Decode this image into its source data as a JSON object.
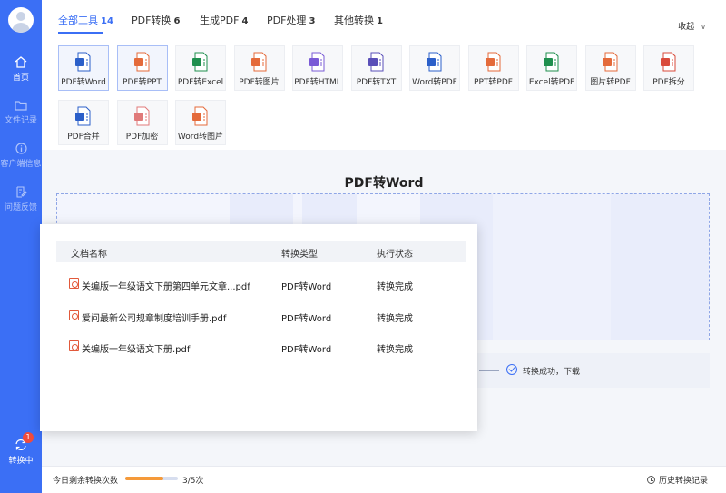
{
  "sidebar": {
    "items": [
      {
        "label": "首页",
        "icon": "home-icon"
      },
      {
        "label": "文件记录",
        "icon": "folder-icon"
      },
      {
        "label": "客户端信息",
        "icon": "info-icon"
      },
      {
        "label": "问题反馈",
        "icon": "feedback-icon"
      }
    ],
    "converting": {
      "label": "转换中",
      "badge": "1",
      "icon": "sync-icon"
    }
  },
  "header": {
    "tabs": [
      {
        "label": "全部工具",
        "count": "14"
      },
      {
        "label": "PDF转换",
        "count": "6"
      },
      {
        "label": "生成PDF",
        "count": "4"
      },
      {
        "label": "PDF处理",
        "count": "3"
      },
      {
        "label": "其他转换",
        "count": "1"
      }
    ],
    "collapse_label": "收起",
    "accent_color": "#3b6ff5"
  },
  "tools": [
    {
      "label": "PDF转Word",
      "icon": "word-icon",
      "color": "#2b5fc9"
    },
    {
      "label": "PDF转PPT",
      "icon": "ppt-icon",
      "color": "#e46a3a"
    },
    {
      "label": "PDF转Excel",
      "icon": "excel-icon",
      "color": "#1f8f4e"
    },
    {
      "label": "PDF转图片",
      "icon": "image-icon",
      "color": "#e46a3a"
    },
    {
      "label": "PDF转HTML",
      "icon": "html-icon",
      "color": "#7a5bd6"
    },
    {
      "label": "PDF转TXT",
      "icon": "txt-icon",
      "color": "#5a4fb8"
    },
    {
      "label": "Word转PDF",
      "icon": "word-to-pdf-icon",
      "color": "#2b5fc9"
    },
    {
      "label": "PPT转PDF",
      "icon": "ppt-to-pdf-icon",
      "color": "#e46a3a"
    },
    {
      "label": "Excel转PDF",
      "icon": "excel-to-pdf-icon",
      "color": "#1f8f4e"
    },
    {
      "label": "图片转PDF",
      "icon": "image-to-pdf-icon",
      "color": "#e46a3a"
    },
    {
      "label": "PDF拆分",
      "icon": "split-icon",
      "color": "#d94a3a"
    },
    {
      "label": "PDF合并",
      "icon": "merge-icon",
      "color": "#2b5fc9"
    },
    {
      "label": "PDF加密",
      "icon": "lock-icon",
      "color": "#e07a7a"
    },
    {
      "label": "Word转图片",
      "icon": "word-to-image-icon",
      "color": "#e46a3a"
    }
  ],
  "main": {
    "title": "PDF转Word",
    "status_text": "转换成功，下载"
  },
  "panel": {
    "headers": [
      "文档名称",
      "转换类型",
      "执行状态"
    ],
    "rows": [
      {
        "name": "关编版一年级语文下册第四单元文章...pdf",
        "type": "PDF转Word",
        "status": "转换完成"
      },
      {
        "name": "爱问最新公司规章制度培训手册.pdf",
        "type": "PDF转Word",
        "status": "转换完成"
      },
      {
        "name": "关编版一年级语文下册.pdf",
        "type": "PDF转Word",
        "status": "转换完成"
      }
    ]
  },
  "footer": {
    "quota_label": "今日剩余转换次数",
    "quota_count": "3/5次",
    "quota_fraction": 0.72,
    "history_label": "历史转换记录"
  }
}
